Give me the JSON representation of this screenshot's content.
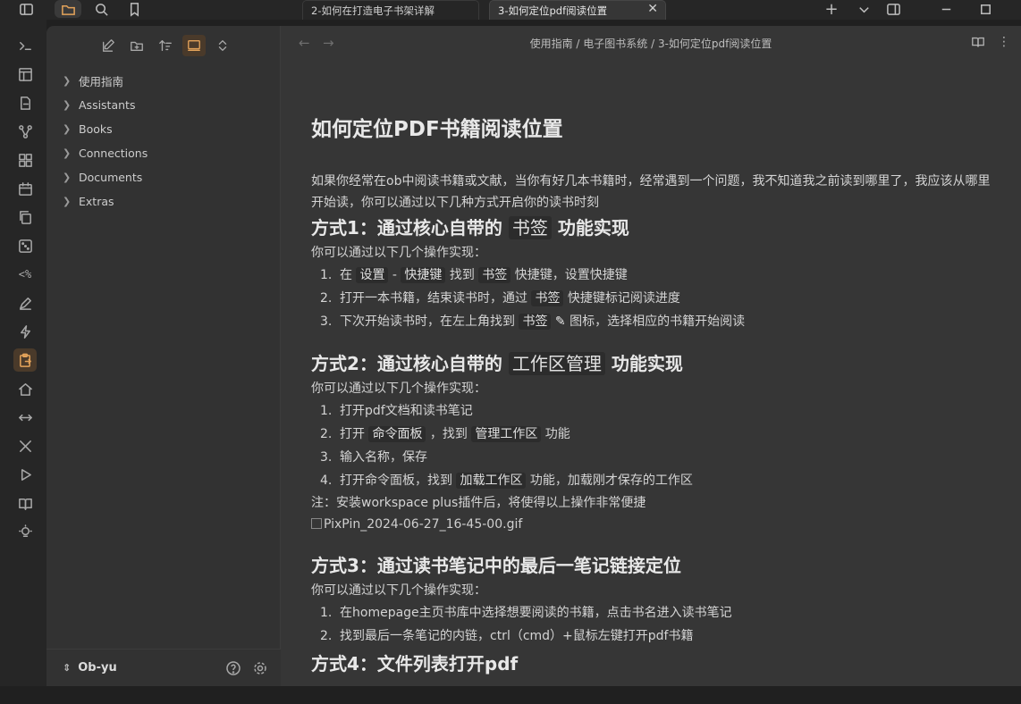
{
  "titlebar": {
    "tabs": [
      {
        "label": "2-如何在打造电子书架详解"
      },
      {
        "label": "3-如何定位pdf阅读位置"
      }
    ],
    "close_symbol": "✕"
  },
  "ribbon": {
    "items": [
      "terminal-icon",
      "layout-icon",
      "file-export-icon",
      "graph-icon",
      "blocks-icon",
      "calendar-icon",
      "copy-icon",
      "dice-icon",
      "regex-icon",
      "pen-icon",
      "lightning-icon",
      "clipboard-icon",
      "home-icon",
      "arrows-h-icon",
      "tools-icon",
      "play-icon",
      "book-icon",
      "bulb-icon"
    ],
    "regex_label": "<%"
  },
  "sidebar": {
    "tree": [
      {
        "label": "使用指南"
      },
      {
        "label": "Assistants"
      },
      {
        "label": "Books"
      },
      {
        "label": "Connections"
      },
      {
        "label": "Documents"
      },
      {
        "label": "Extras"
      }
    ],
    "vault_name": "Ob-yu"
  },
  "editor": {
    "breadcrumb": "使用指南 / 电子图书系统 / 3-如何定位pdf阅读位置",
    "title": "如何定位PDF书籍阅读位置",
    "intro": "如果你经常在ob中阅读书籍或文献，当你有好几本书籍时，经常遇到一个问题，我不知道我之前读到哪里了，我应该从哪里开始读，你可以通过以下几种方式开启你的读书时刻",
    "method1": {
      "h_pre": "方式1：通过核心自带的 ",
      "h_code": "书签",
      "h_post": " 功能实现",
      "lead": "你可以通过以下几个操作实现：",
      "s1": {
        "n": "1.",
        "a": "在 ",
        "c1": "设置",
        "b": " - ",
        "c2": "快捷键",
        "c": " 找到 ",
        "c3": "书签",
        "d": " 快捷键，设置快捷键"
      },
      "s2": {
        "n": "2.",
        "a": "打开一本书籍，结束读书时，通过 ",
        "c1": "书签",
        "b": " 快捷键标记阅读进度"
      },
      "s3": {
        "n": "3.",
        "a": "下次开始读书时，在左上角找到 ",
        "c1": "书签",
        "b": " 图标，选择相应的书籍开始阅读"
      }
    },
    "method2": {
      "h_pre": "方式2：通过核心自带的 ",
      "h_code": "工作区管理",
      "h_post": " 功能实现",
      "lead": "你可以通过以下几个操作实现：",
      "s1": {
        "n": "1.",
        "a": "打开pdf文档和读书笔记"
      },
      "s2": {
        "n": "2.",
        "a": "打开 ",
        "c1": "命令面板",
        "b": " ，找到 ",
        "c2": "管理工作区",
        "c": " 功能"
      },
      "s3": {
        "n": "3.",
        "a": "输入名称，保存"
      },
      "s4": {
        "n": "4.",
        "a": "打开命令面板，找到 ",
        "c1": "加载工作区",
        "b": " 功能，加载刚才保存的工作区"
      },
      "note": "注：安装workspace plus插件后，将使得以上操作非常便捷",
      "image_alt": "PixPin_2024-06-27_16-45-00.gif"
    },
    "method3": {
      "h": "方式3：通过读书笔记中的最后一笔记链接定位",
      "lead": "你可以通过以下几个操作实现：",
      "s1": {
        "n": "1.",
        "a": "在homepage主页书库中选择想要阅读的书籍，点击书名进入读书笔记"
      },
      "s2": {
        "n": "2.",
        "a": "找到最后一条笔记的内链，ctrl（cmd）+鼠标左键打开pdf书籍"
      }
    },
    "method4_partial": "方式4：文件列表打开pdf"
  },
  "colors": {
    "accent": "#e3a35a",
    "bg": "#202020",
    "editor_bg": "#363636"
  }
}
